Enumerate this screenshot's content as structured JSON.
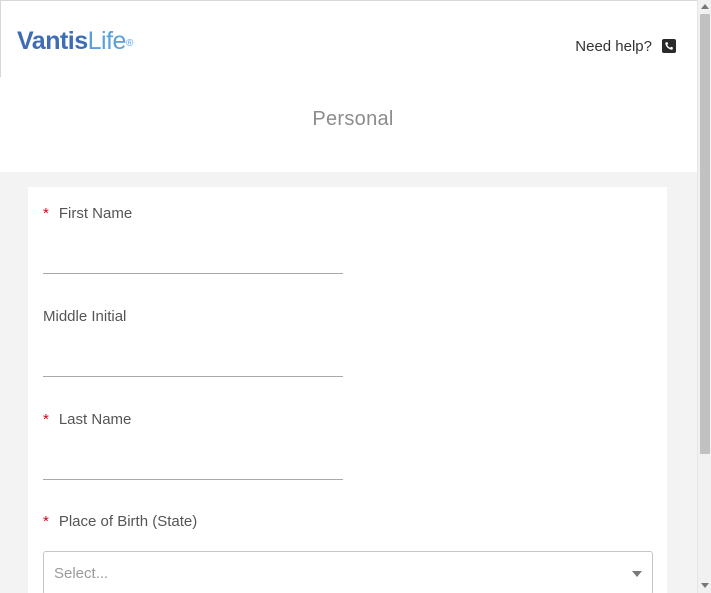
{
  "header": {
    "logo": {
      "brand_main": "Vantis",
      "brand_sub": "Life",
      "brand_mark": "®"
    },
    "help_text": "Need help?",
    "help_icon": "phone-icon"
  },
  "page": {
    "title": "Personal"
  },
  "form": {
    "first_name": {
      "label": "First Name",
      "required": "*",
      "value": ""
    },
    "middle_initial": {
      "label": "Middle Initial",
      "value": ""
    },
    "last_name": {
      "label": "Last Name",
      "required": "*",
      "value": ""
    },
    "place_of_birth": {
      "label": "Place of Birth (State)",
      "required": "*",
      "placeholder": "Select..."
    }
  },
  "colors": {
    "brand_dark": "#3f6cb6",
    "brand_light": "#5aa0dd",
    "required": "#d0021b"
  }
}
